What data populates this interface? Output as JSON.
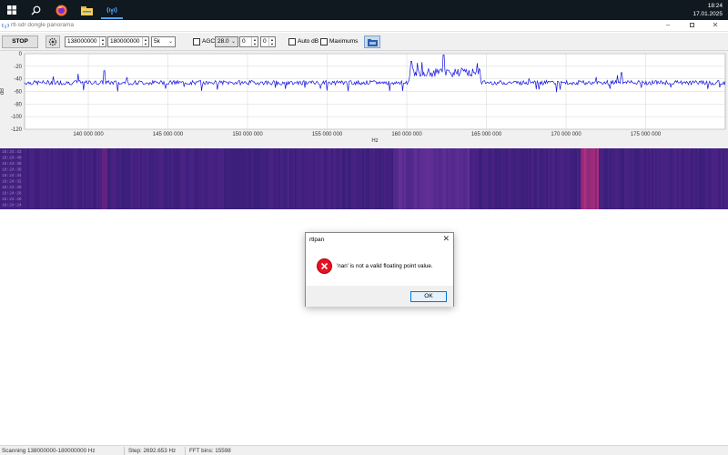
{
  "taskbar": {
    "icons": [
      "windows-start-icon",
      "search-icon",
      "firefox-icon",
      "file-explorer-icon",
      "rtlsdr-app-icon"
    ],
    "time": "18:24",
    "date": "17.01.2025"
  },
  "window": {
    "title": "rtl-sdr dongle panorama"
  },
  "toolbar": {
    "stop_label": "STOP",
    "start_freq": "138000000",
    "end_freq": "180000000",
    "step": "5k",
    "agc_label": "AGC",
    "agc_value": "28.0",
    "val1": "0",
    "val2": "0",
    "autodb_label": "Auto dB",
    "maximums_label": "Maximums"
  },
  "chart_data": {
    "type": "line",
    "ylabel": "dB",
    "xlabel": "Hz",
    "ylim": [
      -120,
      0
    ],
    "yticks": [
      "0",
      "-20",
      "-40",
      "-60",
      "-80",
      "-100",
      "-120"
    ],
    "xlim": [
      136000000,
      180000000
    ],
    "xtick_values": [
      140000000,
      145000000,
      150000000,
      155000000,
      160000000,
      165000000,
      170000000,
      175000000
    ],
    "xtick_labels": [
      "140 000 000",
      "145 000 000",
      "150 000 000",
      "155 000 000",
      "160 000 000",
      "165 000 000",
      "170 000 000",
      "175 000 000"
    ],
    "noise_floor": -46,
    "series_color": "#1010e0",
    "features": [
      {
        "x_start": 160200000,
        "x_end": 164600000,
        "level": -30
      },
      {
        "x": 162300000,
        "peak": -2
      },
      {
        "x": 160300000,
        "peak": -12
      },
      {
        "x": 164400000,
        "peak": -15
      },
      {
        "x": 141000000,
        "peak": -27
      },
      {
        "x": 173500000,
        "peak": -30
      }
    ],
    "grid": true
  },
  "waterfall": {
    "labels": [
      "18:24:42",
      "18:24:40",
      "18:24:38",
      "18:24:36",
      "18:24:34",
      "18:24:32",
      "18:24:30",
      "18:24:28",
      "18:24:26",
      "18:24:24"
    ],
    "base_color": "#3a1f7a",
    "hot_color": "#c0307a"
  },
  "dialog": {
    "title": "rtlpan",
    "message": "'nan' is not a valid floating point value.",
    "ok_label": "OK"
  },
  "statusbar": {
    "scanning": "Scanning 138000000-180000000 Hz",
    "step": "Step: 2692.653 Hz",
    "fft": "FFT bins: 15598"
  }
}
